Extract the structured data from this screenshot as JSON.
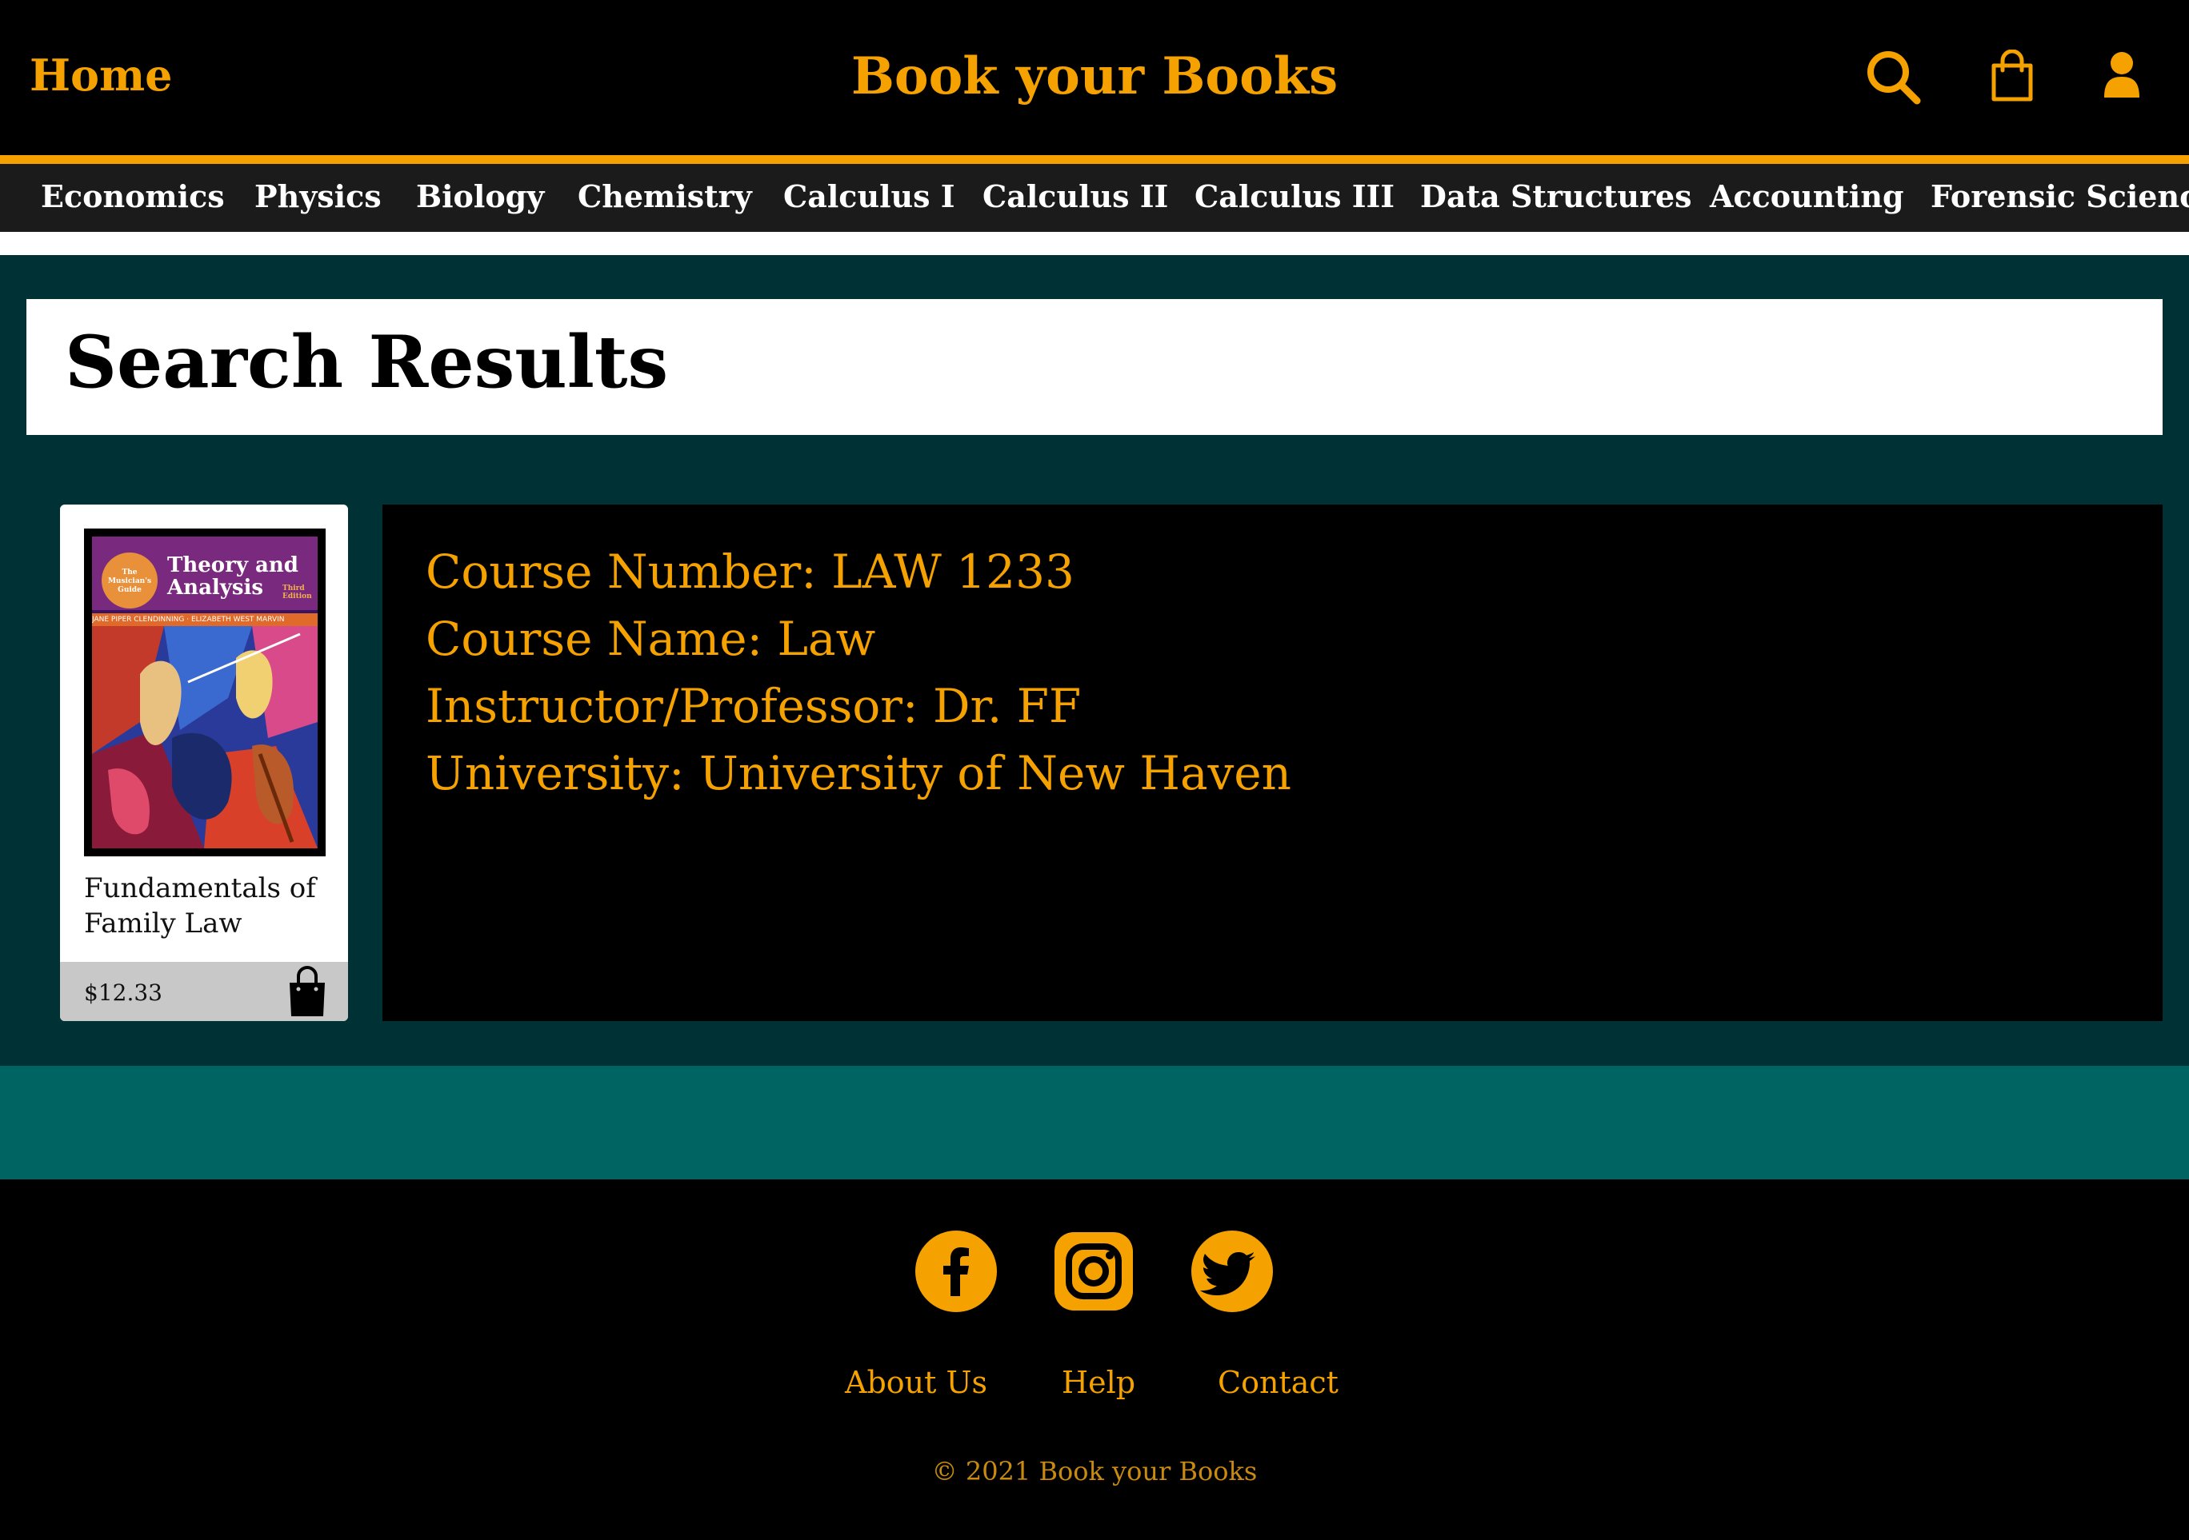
{
  "header": {
    "home_label": "Home",
    "site_title": "Book your Books",
    "icons": [
      "search-icon",
      "shopping-bag-icon",
      "user-icon"
    ],
    "accent_color": "#f5a200"
  },
  "categories": [
    "Economics",
    "Physics",
    "Biology",
    "Chemistry",
    "Calculus I",
    "Calculus II",
    "Calculus III",
    "Data Structures",
    "Accounting",
    "Forensic Science"
  ],
  "results": {
    "title": "Search Results",
    "book": {
      "cover": {
        "badge": "The Musician's Guide",
        "title_line1": "Theory and",
        "title_line2": "Analysis",
        "edition": "Third Edition",
        "authors": "JANE PIPER CLENDINNING · ELIZABETH WEST MARVIN"
      },
      "name": "Fundamentals of Family Law",
      "price": "$12.33"
    },
    "details": {
      "course_number": "Course Number: LAW 1233",
      "course_name": "Course Name: Law",
      "instructor": "Instructor/Professor: Dr. FF",
      "university": "University: University of New Haven"
    }
  },
  "footer": {
    "social": [
      "facebook-icon",
      "instagram-icon",
      "twitter-icon"
    ],
    "links": [
      "About Us",
      "Help",
      "Contact"
    ],
    "copyright": "© 2021 Book your Books"
  }
}
